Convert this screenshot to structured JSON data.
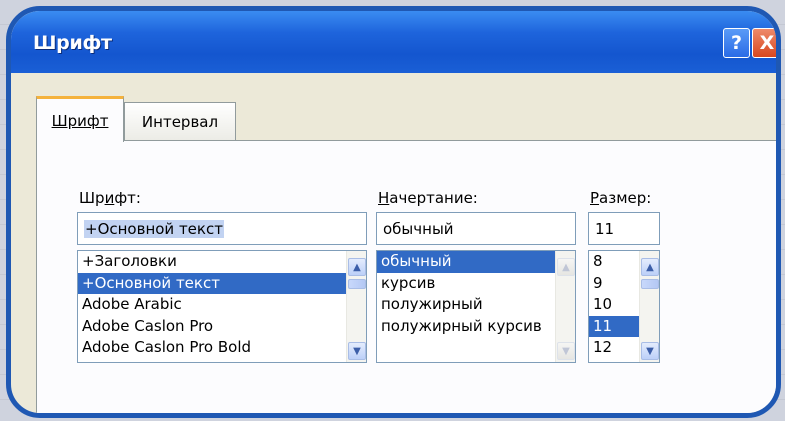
{
  "window": {
    "title": "Шрифт",
    "help_label": "?",
    "close_label": "X"
  },
  "tabs": [
    {
      "label": "Шрифт",
      "active": true
    },
    {
      "label": "Интервал",
      "active": false
    }
  ],
  "font": {
    "label_prefix": "Шр",
    "label_u": "и",
    "label_suffix": "фт:",
    "value": "+Основной текст",
    "items": [
      "+Заголовки",
      "+Основной текст",
      "Adobe Arabic",
      "Adobe Caslon Pro",
      "Adobe Caslon Pro Bold"
    ],
    "selected_index": 1
  },
  "style": {
    "label_u": "Н",
    "label_rest": "ачертание:",
    "value": "обычный",
    "items": [
      "обычный",
      "курсив",
      "полужирный",
      "полужирный курсив"
    ],
    "selected_index": 0
  },
  "size": {
    "label_u": "Р",
    "label_rest": "азмер:",
    "value": "11",
    "items": [
      "8",
      "9",
      "10",
      "11",
      "12"
    ],
    "selected_index": 3
  },
  "colors": {
    "title_bar": "#1456cf",
    "selection": "#316ac5",
    "tab_accent": "#f4b23d",
    "close_button": "#d8471f"
  },
  "icons": [
    "help-icon",
    "close-icon",
    "scroll-up-icon",
    "scroll-down-icon"
  ]
}
